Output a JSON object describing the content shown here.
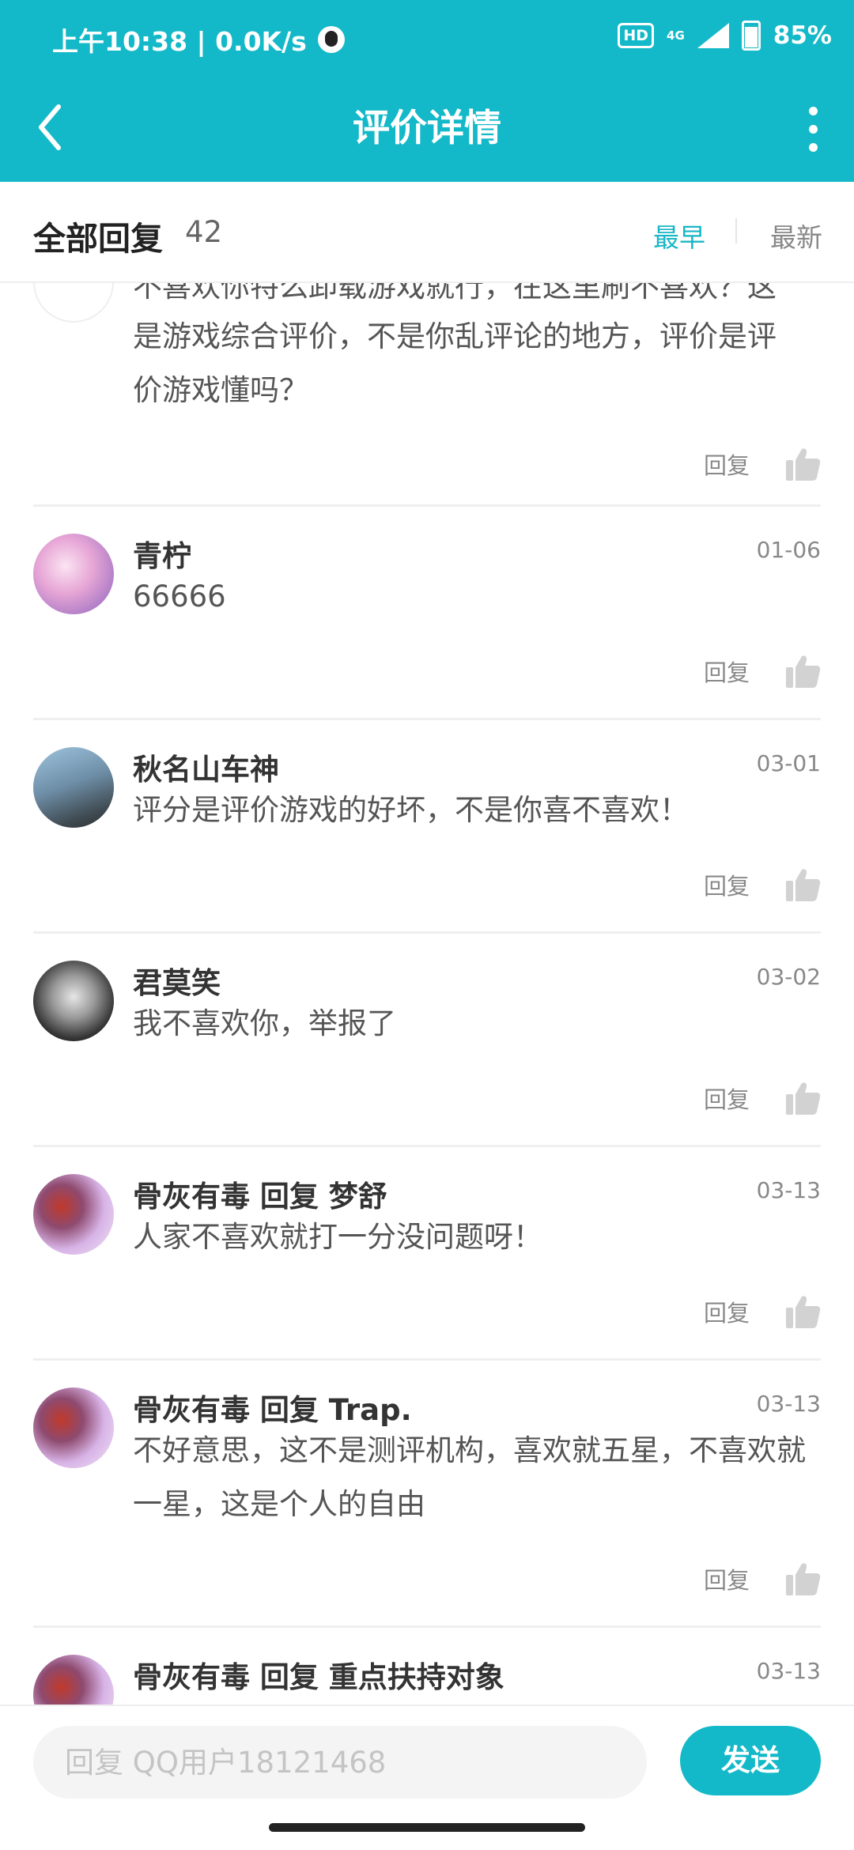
{
  "status": {
    "time_net": "上午10:38 | 0.0K/s",
    "hd": "HD",
    "network": "4G",
    "battery": "85%"
  },
  "appbar": {
    "title": "评价详情"
  },
  "sort": {
    "title": "全部回复",
    "count": "42",
    "earliest": "最早",
    "latest": "最新"
  },
  "partial": {
    "cut_line": "不喜欢你特么卸载游戏就行，在这里刷不喜欢？这",
    "text": "是游戏综合评价，不是你乱评论的地方，评价是评价游戏懂吗？"
  },
  "reply_label": "回复",
  "comments": [
    {
      "name": "青柠",
      "date": "01-06",
      "text": "66666"
    },
    {
      "name": "秋名山车神",
      "date": "03-01",
      "text": "评分是评价游戏的好坏，不是你喜不喜欢！"
    },
    {
      "name": "君莫笑",
      "date": "03-02",
      "text": "我不喜欢你，举报了"
    },
    {
      "name": "骨灰有毒  回复  梦舒",
      "date": "03-13",
      "text": "人家不喜欢就打一分没问题呀！"
    },
    {
      "name": "骨灰有毒  回复  Trap.",
      "date": "03-13",
      "text": "不好意思，这不是测评机构，喜欢就五星，不喜欢就一星，这是个人的自由"
    },
    {
      "name": "骨灰有毒  回复  重点扶持对象",
      "date": "03-13",
      "text": ""
    }
  ],
  "reply_box": {
    "placeholder": "回复 QQ用户18121468",
    "send": "发送"
  },
  "colors": {
    "accent": "#13b9c8"
  }
}
